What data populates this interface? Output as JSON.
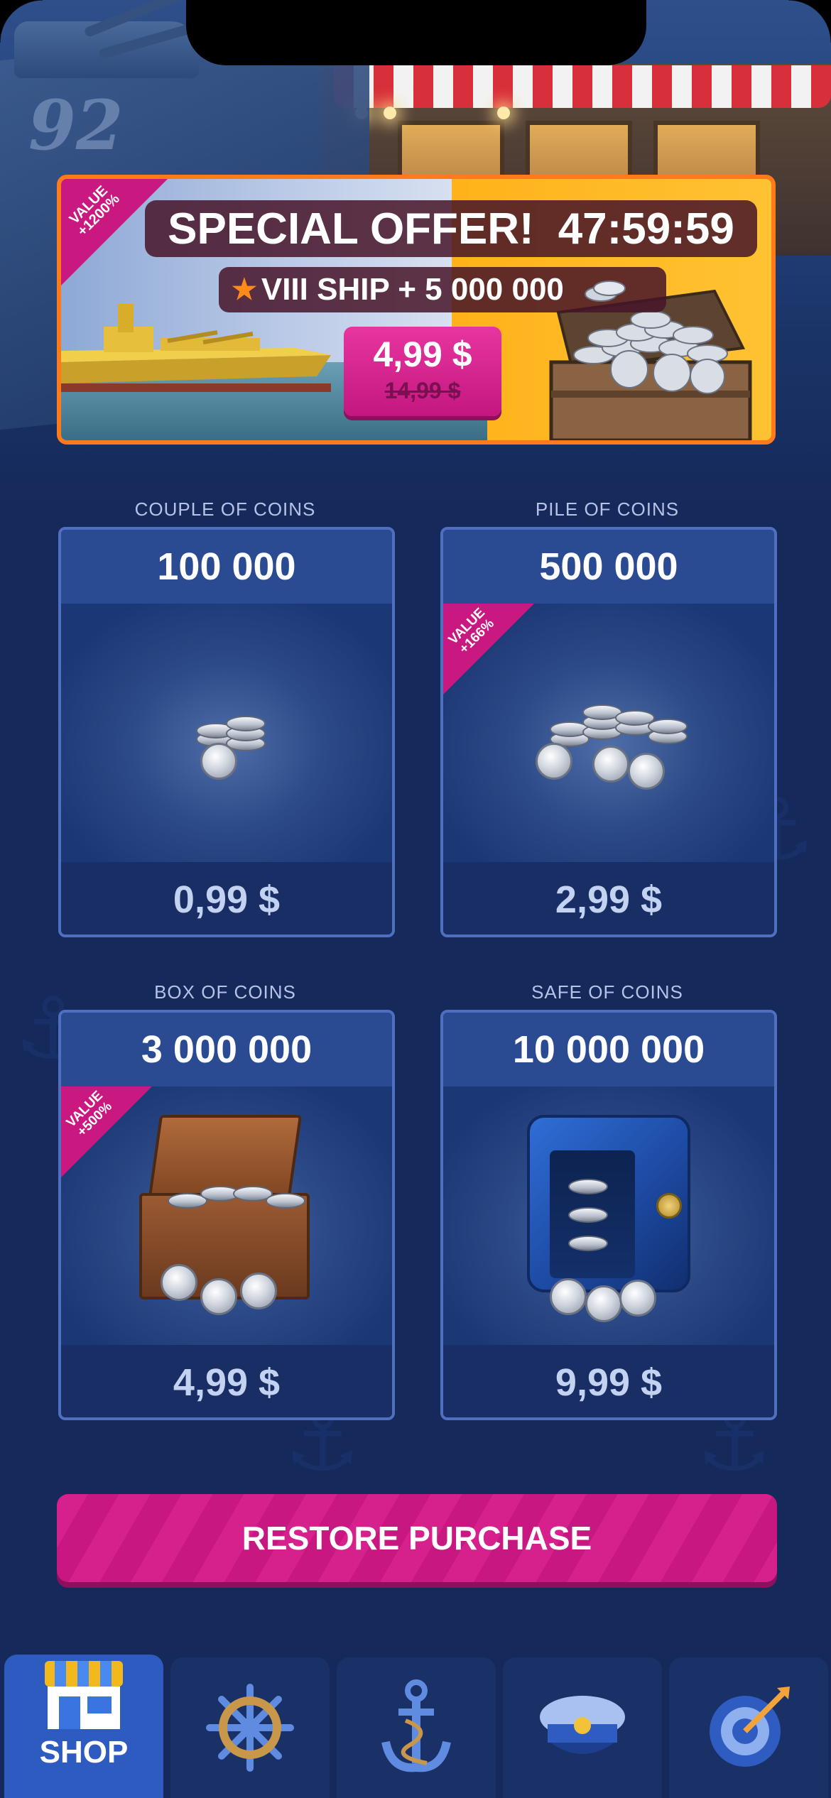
{
  "offer": {
    "ribbon_line1": "VALUE",
    "ribbon_line2": "+1200%",
    "title": "SPECIAL OFFER!",
    "timer": "47:59:59",
    "subtitle": "VIII SHIP + 5 000 000",
    "price": "4,99 $",
    "old_price": "14,99 $"
  },
  "packs": [
    {
      "label": "COUPLE OF COINS",
      "amount": "100 000",
      "price": "0,99 $",
      "ribbon_line1": "",
      "ribbon_line2": ""
    },
    {
      "label": "PILE OF COINS",
      "amount": "500 000",
      "price": "2,99 $",
      "ribbon_line1": "VALUE",
      "ribbon_line2": "+166%"
    },
    {
      "label": "BOX OF COINS",
      "amount": "3 000 000",
      "price": "4,99 $",
      "ribbon_line1": "VALUE",
      "ribbon_line2": "+500%"
    },
    {
      "label": "SAFE OF COINS",
      "amount": "10 000 000",
      "price": "9,99 $",
      "ribbon_line1": "",
      "ribbon_line2": ""
    }
  ],
  "restore_label": "RESTORE PURCHASE",
  "nav": {
    "items": [
      {
        "label": "SHOP",
        "icon": "shop-icon",
        "active": true
      },
      {
        "label": "",
        "icon": "ship-wheel-icon",
        "active": false
      },
      {
        "label": "",
        "icon": "anchor-icon",
        "active": false
      },
      {
        "label": "",
        "icon": "captain-hat-icon",
        "active": false
      },
      {
        "label": "",
        "icon": "target-icon",
        "active": false
      }
    ]
  },
  "colors": {
    "background": "#15295a",
    "accent_pink": "#d6208b",
    "offer_border": "#ff7a1a",
    "pack_border": "#4f6fc0",
    "nav_active": "#2d5bbf"
  },
  "scene": {
    "hull_number": "92"
  }
}
